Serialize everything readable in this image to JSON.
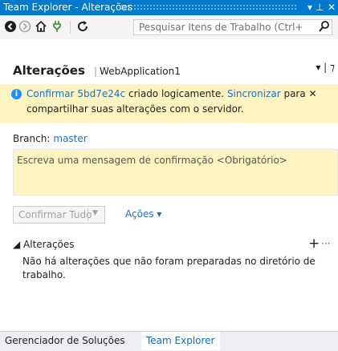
{
  "window": {
    "title": "Team Explorer - Alterações",
    "pin_glyph": "▾ ᵖ",
    "close_glyph": "✕"
  },
  "toolbar": {
    "back_icon": "arrow-left-circle-icon",
    "forward_icon": "arrow-right-circle-icon",
    "home_icon": "home-icon",
    "connect_icon": "plug-icon",
    "refresh_icon": "refresh-icon",
    "search_placeholder": "Pesquisar Itens de Trabalho (Ctrl+",
    "search_icon": "search-icon"
  },
  "header": {
    "title": "Alterações",
    "subtitle": "WebApplication1",
    "right": "▾ | ⁊"
  },
  "notice": {
    "link_commit": "Confirmar 5bd7e24c",
    "text_middle": " criado logicamente. ",
    "link_sync": "Sincronizar",
    "text_end": " para ",
    "line2": "compartilhar suas alterações com o servidor."
  },
  "branch": {
    "label": "Branch:",
    "value": "master"
  },
  "commit": {
    "placeholder": "Escreva uma mensagem de confirmação <Obrigatório>",
    "commit_all": "Confirmar Tudo",
    "actions": "Ações ▾"
  },
  "changes": {
    "title": "◢ Alterações",
    "empty_text": "Não há alterações que não foram preparadas no diretório de trabalho."
  },
  "tabs": [
    {
      "label": "Gerenciador de Soluções"
    },
    {
      "label": "Team Explorer"
    }
  ],
  "colors": {
    "accent": "#007acc",
    "notice_bg": "#fdf4bf",
    "link": "#1e6fc2"
  }
}
